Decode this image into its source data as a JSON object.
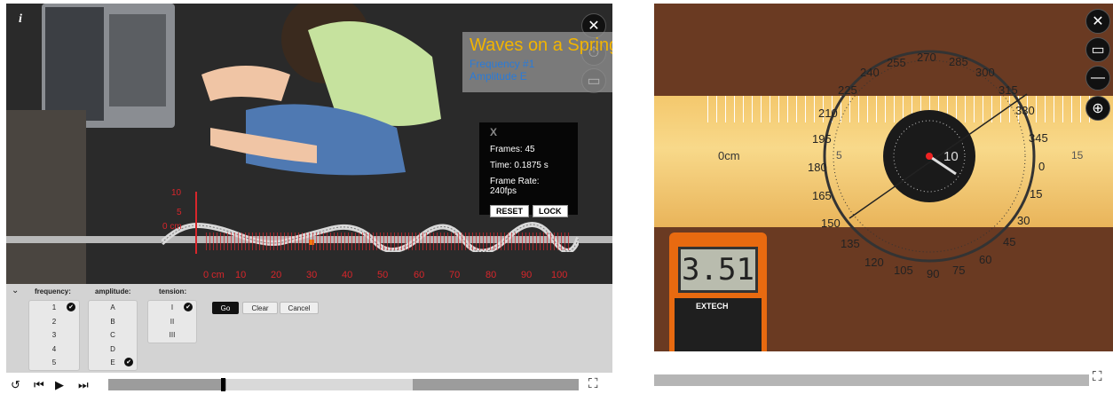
{
  "left_view": {
    "info_label": "i",
    "title": "Waves on a Spring",
    "subtitle1": "Frequency #1",
    "subtitle2": "Amplitude E",
    "timer": {
      "close": "X",
      "frames": "Frames: 45",
      "time": "Time: 0.1875 s",
      "frame_rate": "Frame Rate: 240fps",
      "reset": "RESET",
      "lock": "LOCK"
    },
    "y_ruler": [
      "10",
      "5",
      "0 cm"
    ],
    "x_ruler": [
      "0 cm",
      "10",
      "20",
      "30",
      "40",
      "50",
      "60",
      "70",
      "80",
      "90",
      "100"
    ]
  },
  "controls": {
    "collapse_icon": "chevron-down-icon",
    "frequency_label": "frequency:",
    "frequency_options": [
      "1",
      "2",
      "3",
      "4",
      "5"
    ],
    "frequency_selected": "1",
    "amplitude_label": "amplitude:",
    "amplitude_options": [
      "A",
      "B",
      "C",
      "D",
      "E"
    ],
    "amplitude_selected": "E",
    "tension_label": "tension:",
    "tension_options": [
      "I",
      "II",
      "III"
    ],
    "tension_selected": "I",
    "go": "Go",
    "clear": "Clear",
    "cancel": "Cancel"
  },
  "playback": {
    "progress_position": 0.24
  },
  "right_view": {
    "ruler_label": "0cm",
    "ruler_mark_5": "5",
    "ruler_mark_15": "15",
    "dial_number": "10",
    "protractor": [
      "0",
      "15",
      "30",
      "45",
      "60",
      "75",
      "90",
      "105",
      "120",
      "135",
      "150",
      "165",
      "180",
      "195",
      "210",
      "225",
      "240",
      "255",
      "270",
      "285",
      "300",
      "315",
      "330",
      "345"
    ],
    "meter_display": "3.51",
    "meter_brand": "EXTECH"
  },
  "colors": {
    "title": "#f2b400",
    "subtitle": "#2a7bd8",
    "ruler": "#d8262b"
  }
}
